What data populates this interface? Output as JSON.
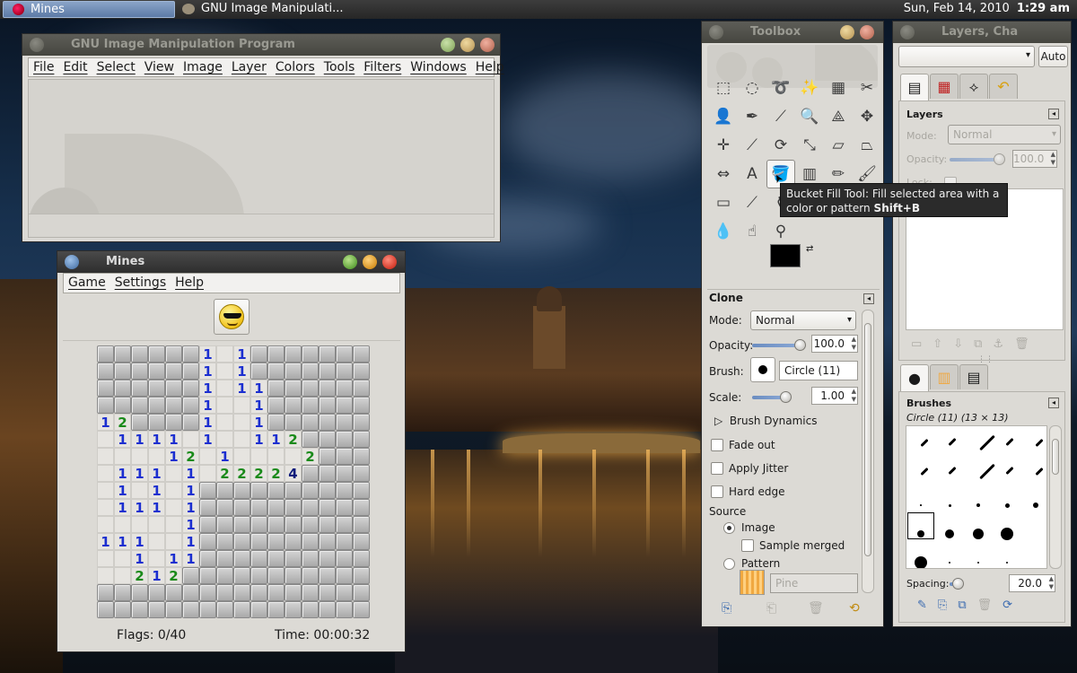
{
  "panel": {
    "taskbar": [
      {
        "label": "Mines",
        "active": true
      },
      {
        "label": "GNU Image Manipulati..."
      }
    ],
    "clock_date": "Sun, Feb 14, 2010",
    "clock_time": "1:29 am"
  },
  "gimp_window": {
    "title": "GNU Image Manipulation Program",
    "menu": [
      "File",
      "Edit",
      "Select",
      "View",
      "Image",
      "Layer",
      "Colors",
      "Tools",
      "Filters",
      "Windows",
      "Help"
    ]
  },
  "mines_window": {
    "title": "Mines",
    "menu": [
      "Game",
      "Settings",
      "Help"
    ],
    "flags": "Flags: 0/40",
    "time": "Time: 00:00:32",
    "board": [
      "######1.1#######",
      "######1.1#######",
      "######1.11######",
      "######1..1######",
      "12####1..1######",
      ".1111.1..112####",
      "....12.1....2###",
      ".111.1.22224####",
      ".1.1.1##########",
      ".111.1##########",
      ".....1##########",
      "111..1##########",
      "..1.11##########",
      "..212###########",
      "################",
      "################"
    ]
  },
  "toolbox": {
    "title": "Toolbox",
    "tools": [
      {
        "name": "rect-select-tool-icon",
        "glyph": "⬚"
      },
      {
        "name": "ellipse-select-tool-icon",
        "glyph": "◌"
      },
      {
        "name": "free-select-tool-icon",
        "glyph": "➰"
      },
      {
        "name": "fuzzy-select-tool-icon",
        "glyph": "✨"
      },
      {
        "name": "select-by-color-tool-icon",
        "glyph": "▦"
      },
      {
        "name": "scissors-select-tool-icon",
        "glyph": "✂"
      },
      {
        "name": "foreground-select-tool-icon",
        "glyph": "👤"
      },
      {
        "name": "paths-tool-icon",
        "glyph": "✒"
      },
      {
        "name": "color-picker-tool-icon",
        "glyph": "⟋"
      },
      {
        "name": "zoom-tool-icon",
        "glyph": "🔍"
      },
      {
        "name": "measure-tool-icon",
        "glyph": "⟁"
      },
      {
        "name": "move-tool-icon",
        "glyph": "✥"
      },
      {
        "name": "align-tool-icon",
        "glyph": "✛"
      },
      {
        "name": "crop-tool-icon",
        "glyph": "⟋"
      },
      {
        "name": "rotate-tool-icon",
        "glyph": "⟳"
      },
      {
        "name": "scale-tool-icon",
        "glyph": "⤡"
      },
      {
        "name": "shear-tool-icon",
        "glyph": "▱"
      },
      {
        "name": "perspective-tool-icon",
        "glyph": "⏢"
      },
      {
        "name": "flip-tool-icon",
        "glyph": "⇔"
      },
      {
        "name": "text-tool-icon",
        "glyph": "A"
      },
      {
        "name": "bucket-fill-tool-icon",
        "glyph": "🪣"
      },
      {
        "name": "blend-tool-icon",
        "glyph": "▥"
      },
      {
        "name": "pencil-tool-icon",
        "glyph": "✏"
      },
      {
        "name": "paintbrush-tool-icon",
        "glyph": "🖌"
      },
      {
        "name": "eraser-tool-icon",
        "glyph": "▭"
      },
      {
        "name": "airbrush-tool-icon",
        "glyph": "⟋"
      },
      {
        "name": "ink-tool-icon",
        "glyph": "⚱"
      },
      {
        "name": "clone-tool-icon",
        "glyph": ""
      },
      {
        "name": "heal-tool-icon",
        "glyph": ""
      },
      {
        "name": "perspective-clone-tool-icon",
        "glyph": ""
      },
      {
        "name": "blur-tool-icon",
        "glyph": "💧"
      },
      {
        "name": "smudge-tool-icon",
        "glyph": "☝"
      },
      {
        "name": "dodge-burn-tool-icon",
        "glyph": "⚲"
      }
    ],
    "active_tool_index": 20,
    "tooltip_text": "Bucket Fill Tool: Fill selected area with a color or pattern",
    "tooltip_shortcut": "Shift+B",
    "options": {
      "title": "Clone",
      "mode_label": "Mode:",
      "mode_value": "Normal",
      "opacity_label": "Opacity:",
      "opacity_value": "100.0",
      "opacity_fraction": 1.0,
      "brush_label": "Brush:",
      "brush_value": "Circle (11)",
      "scale_label": "Scale:",
      "scale_value": "1.00",
      "scale_fraction": 0.5,
      "brush_dynamics": "Brush Dynamics",
      "fade_out": "Fade out",
      "apply_jitter": "Apply Jitter",
      "hard_edge": "Hard edge",
      "source_label": "Source",
      "source_image": "Image",
      "sample_merged": "Sample merged",
      "source_pattern": "Pattern",
      "pattern_value": "Pine"
    }
  },
  "layers_window": {
    "title": "Layers, Cha",
    "auto_label": "Auto",
    "layers_title": "Layers",
    "mode_label": "Mode:",
    "mode_value": "Normal",
    "opacity_label": "Opacity:",
    "opacity_value": "100.0",
    "lock_label": "Lock:",
    "brushes_title": "Brushes",
    "brush_info": "Circle (11) (13 × 13)",
    "spacing_label": "Spacing:",
    "spacing_value": "20.0",
    "spacing_fraction": 0.2
  },
  "colors": {
    "foreground": "#000000",
    "background": "#ffffff",
    "mines_number_1": "#1c2fd0",
    "mines_number_2": "#1a8a1a",
    "mines_number_4": "#0a1a7a"
  }
}
